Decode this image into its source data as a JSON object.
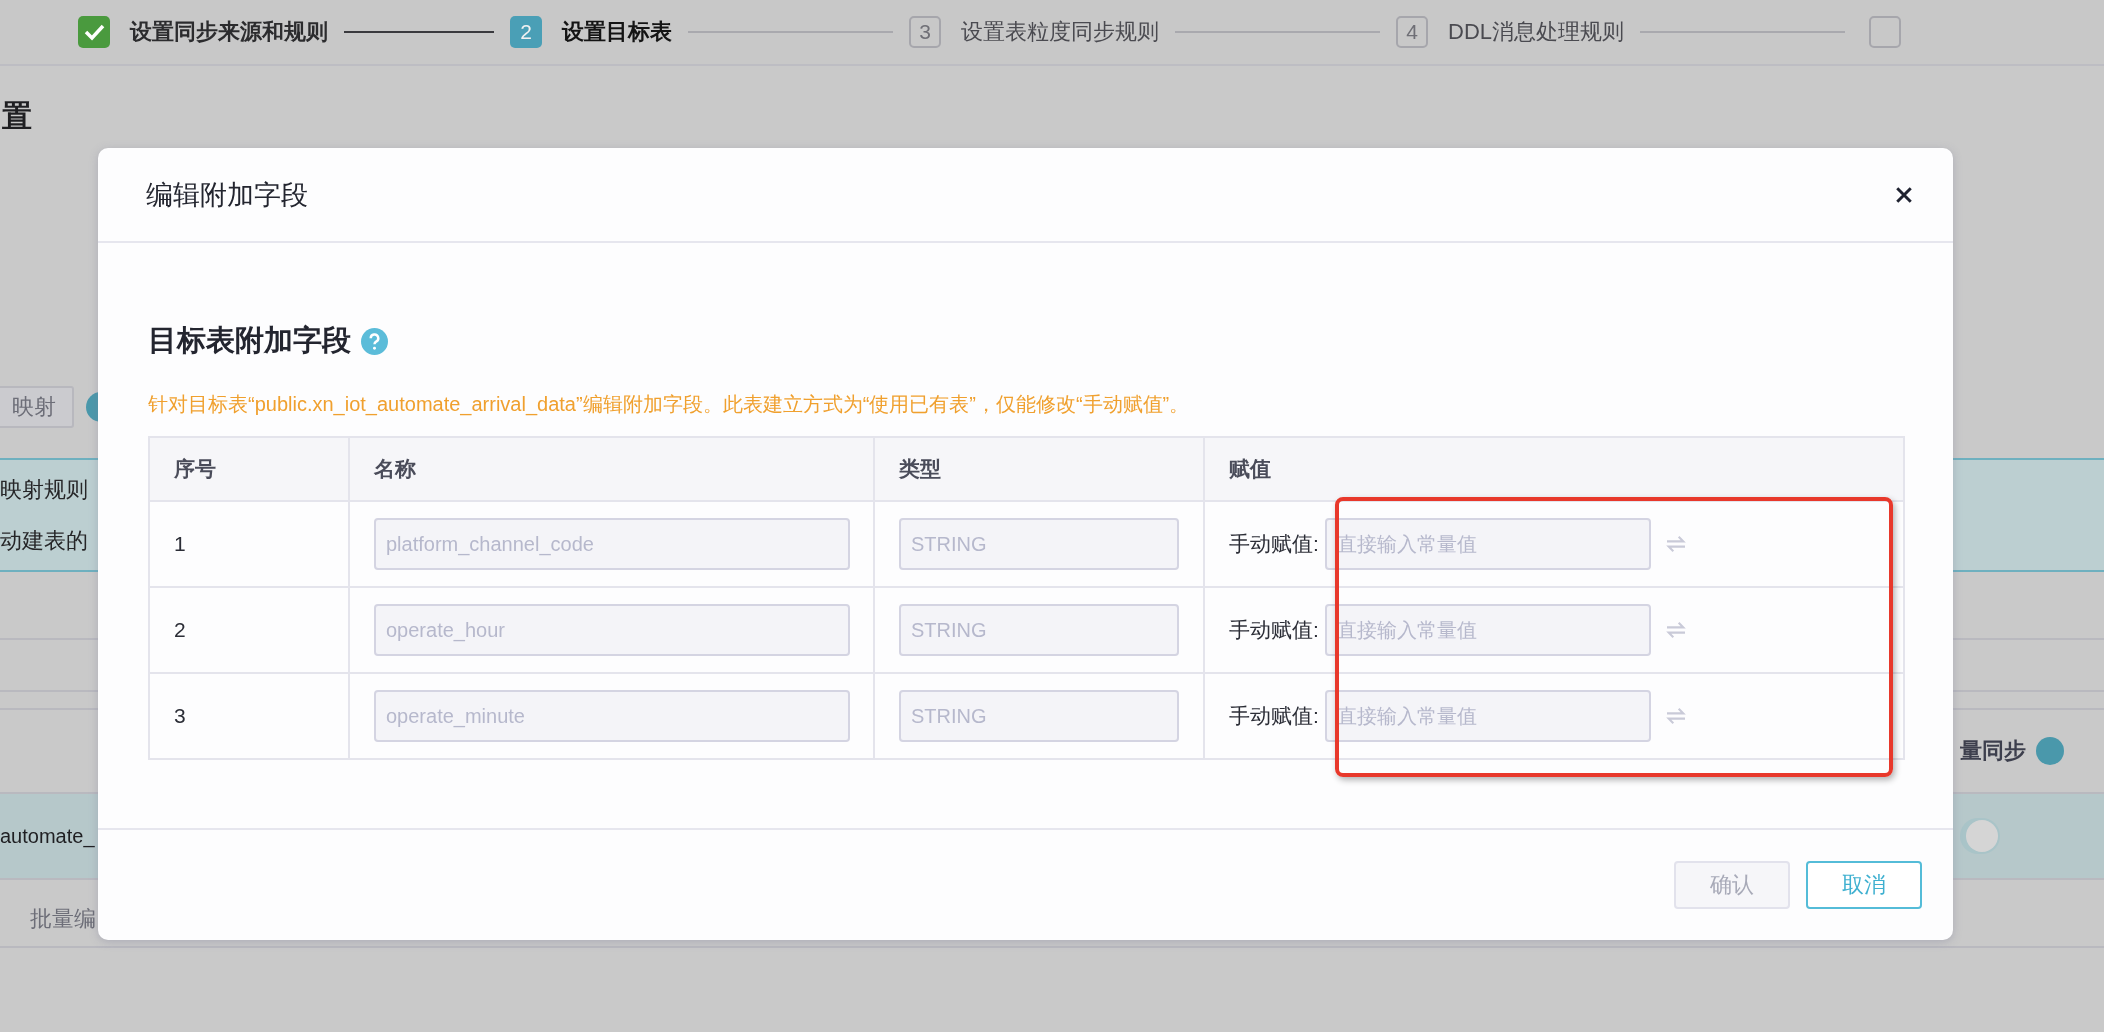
{
  "stepper": {
    "steps": [
      {
        "label": "设置同步来源和规则",
        "completed": true,
        "selected": false
      },
      {
        "number": "2",
        "label": "设置目标表",
        "completed": false,
        "selected": true
      },
      {
        "number": "3",
        "label": "设置表粒度同步规则",
        "completed": false,
        "selected": false
      },
      {
        "number": "4",
        "label": "DDL消息处理规则",
        "completed": false,
        "selected": false
      }
    ]
  },
  "background": {
    "heading": "置",
    "mapping_button": "映射",
    "info_lines": [
      "映射规则",
      "动建表的"
    ],
    "column_header": "量同步",
    "table_cell": "automate_",
    "toggle_on": false,
    "batch_button": "批量编"
  },
  "dialog": {
    "title": "编辑附加字段",
    "section_title": "目标表附加字段",
    "note": "针对目标表“public.xn_iot_automate_arrival_data”编辑附加字段。此表建立方式为“使用已有表”，仅能修改“手动赋值”。",
    "table": {
      "columns": [
        "序号",
        "名称",
        "类型",
        "赋值"
      ],
      "rows": [
        {
          "index": "1",
          "name": "platform_channel_code",
          "type": "STRING",
          "assign_label": "手动赋值:",
          "placeholder": "直接输入常量值"
        },
        {
          "index": "2",
          "name": "operate_hour",
          "type": "STRING",
          "assign_label": "手动赋值:",
          "placeholder": "直接输入常量值"
        },
        {
          "index": "3",
          "name": "operate_minute",
          "type": "STRING",
          "assign_label": "手动赋值:",
          "placeholder": "直接输入常量值"
        }
      ]
    },
    "annotations": [
      {
        "kind": "red-frame"
      }
    ],
    "buttons": [
      {
        "label": "确认",
        "kind": "confirm",
        "disabled": true
      },
      {
        "label": "取消",
        "kind": "cancel",
        "disabled": false
      }
    ]
  }
}
